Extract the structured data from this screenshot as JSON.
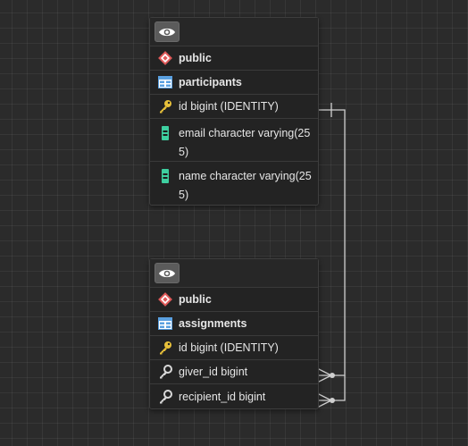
{
  "tables": [
    {
      "schema_label": "public",
      "table_label": "participants",
      "columns": [
        {
          "label": "id bigint (IDENTITY)",
          "icon": "key-icon"
        },
        {
          "label": "email character varying(255)",
          "icon": "column-icon"
        },
        {
          "label": "name character varying(255)",
          "icon": "column-icon"
        }
      ]
    },
    {
      "schema_label": "public",
      "table_label": "assignments",
      "columns": [
        {
          "label": "id bigint (IDENTITY)",
          "icon": "key-icon"
        },
        {
          "label": "giver_id bigint",
          "icon": "foreign-key-icon"
        },
        {
          "label": "recipient_id bigint",
          "icon": "foreign-key-icon"
        }
      ]
    }
  ],
  "colors": {
    "canvas": "#2b2b2b",
    "schema_icon": "#e05a5a",
    "table_icon": "#5aa0e0",
    "key_icon": "#e8c13a",
    "column_icon": "#3ecfa0",
    "relation_line": "#cfcfcf"
  }
}
